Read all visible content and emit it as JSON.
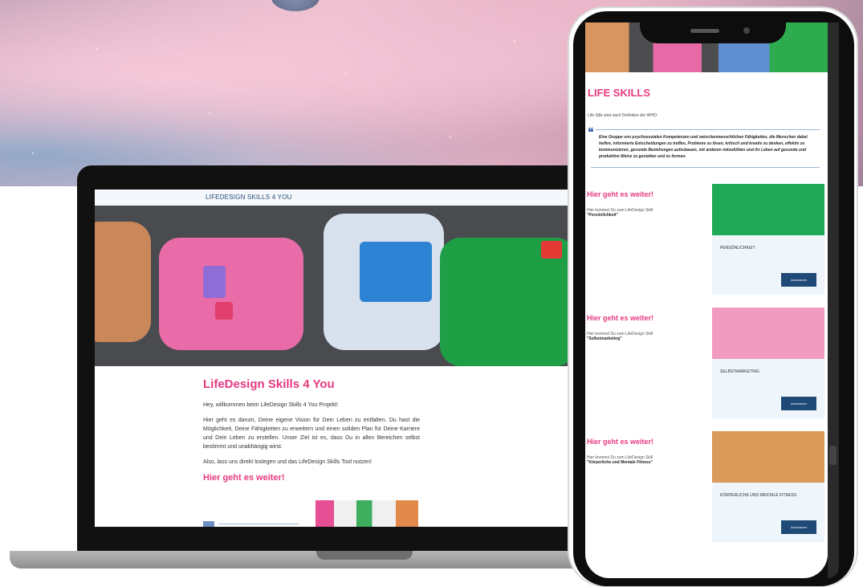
{
  "laptop": {
    "site_header": "LIFEDESIGN SKILLS 4 YOU",
    "title": "LifeDesign Skills 4 You",
    "welcome": "Hey, willkommen beim LifeDesign Skills 4 You Projekt!",
    "intro": "Hier geht es darum, Deine eigene Vision für Dein Leben zu entfalten. Du hast die Möglichkeit, Deine Fähigkeiten zu erweitern und einen soliden Plan für Deine Karriere und Dein Leben zu erstellen. Unser Ziel ist es, dass Du in allen Bereichen selbst bestimmt und unabhängig wirst.",
    "cta": "Also, lass uns direkt loslegen und das LifeDesign Skills Tool nutzen!",
    "next_heading": "Hier geht es weiter!"
  },
  "phone": {
    "section_title": "LIFE SKILLS",
    "definition_intro": "Life Sills sind nach Definition der WHO:",
    "quote": "Eine Gruppe von psychosozialen Kompetenzen und zwischenmenschlichen Fähigkeiten, die Menschen dabei helfen, informierte Entscheidungen zu treffen, Probleme zu lösen, kritisch und kreativ zu denken, effektiv zu kommunizieren, gesunde Beziehungen aufzubauen, mit anderen mitzufühlen und ihr Leben auf gesunde und produktive Weise zu gestalten und zu formen.",
    "cards": [
      {
        "heading": "Hier geht es weiter!",
        "intro": "Hier kommst Du zum LifeDesign Skill",
        "skill": "\"Persönlichkeit\"",
        "caption": "PERSÖNLICHKEIT",
        "button": "Anschauen",
        "image_color": "#1fa957"
      },
      {
        "heading": "Hier geht es weiter!",
        "intro": "Hier kommst Du zum LifeDesign Skill",
        "skill": "\"Selbstmarketing\"",
        "caption": "SELBSTMARKETING",
        "button": "Anschauen",
        "image_color": "#f29bc0"
      },
      {
        "heading": "Hier geht es weiter!",
        "intro": "Hier kommst Du zum LifeDesign Skill",
        "skill": "\"Körperliche und Mentale Fitness\"",
        "caption": "KÖRPERLICHE UND MENTALE FITNESS",
        "button": "Anschauen",
        "image_color": "#d99a5a"
      }
    ]
  }
}
